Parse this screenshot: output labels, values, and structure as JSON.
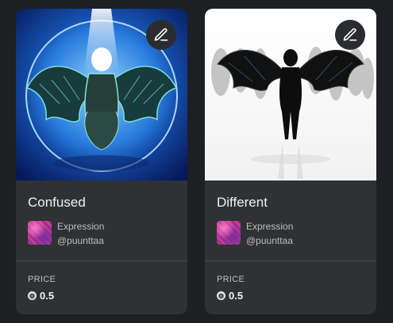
{
  "cards": [
    {
      "title": "Confused",
      "collection": "Expression",
      "handle": "@puunttaa",
      "price_label": "PRICE",
      "price": "0.5",
      "currency_symbol": "◍",
      "icon": "edit-icon",
      "accent": "#1a6bd6"
    },
    {
      "title": "Different",
      "collection": "Expression",
      "handle": "@puunttaa",
      "price_label": "PRICE",
      "price": "0.5",
      "currency_symbol": "◍",
      "icon": "edit-icon",
      "accent": "#ffffff"
    }
  ]
}
